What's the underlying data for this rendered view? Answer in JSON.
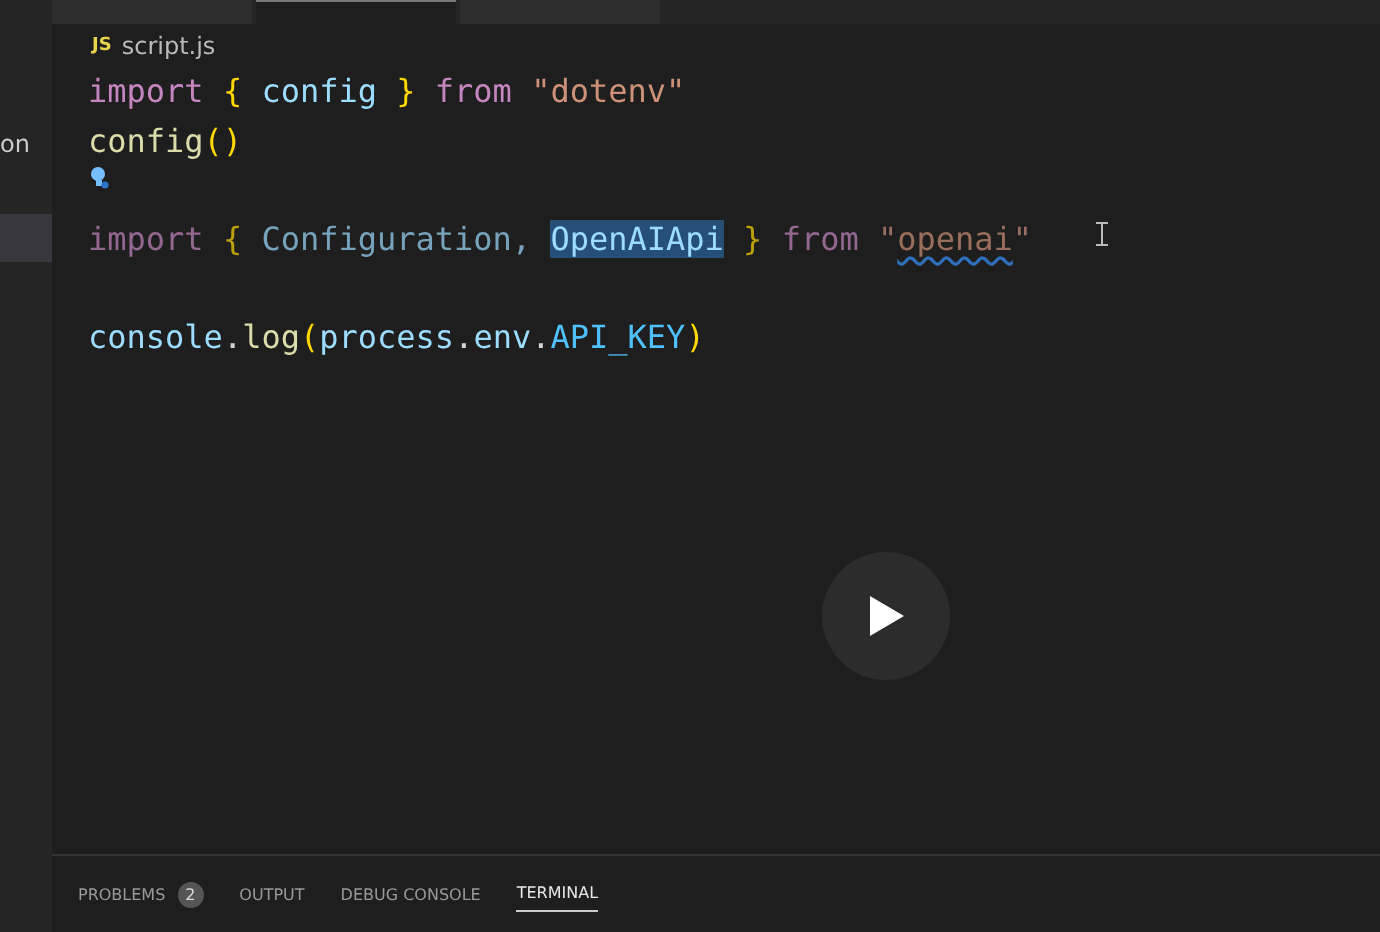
{
  "sidebar": {
    "items": [
      {
        "label": "on",
        "selected": false
      },
      {
        "selected": true
      }
    ]
  },
  "editor_tabs": [
    {
      "selected": false
    },
    {
      "selected": true
    },
    {
      "selected": false
    }
  ],
  "breadcrumb": {
    "file_icon": "JS",
    "file": "script.js"
  },
  "editor": {
    "lines": [
      {
        "faded": false,
        "tokens": [
          {
            "text": "import ",
            "kind": "keyword"
          },
          {
            "text": "{ ",
            "kind": "brace"
          },
          {
            "text": "config ",
            "kind": "variable"
          },
          {
            "text": "} ",
            "kind": "brace"
          },
          {
            "text": "from ",
            "kind": "keyword"
          },
          {
            "text": "\"dotenv\"",
            "kind": "string"
          }
        ]
      },
      {
        "faded": false,
        "tokens": [
          {
            "text": "config",
            "kind": "function"
          },
          {
            "text": "()",
            "kind": "brace"
          }
        ]
      },
      {
        "lightbulb": true
      },
      {
        "faded": true,
        "tokens": [
          {
            "text": "import ",
            "kind": "keyword"
          },
          {
            "text": "{ ",
            "kind": "brace"
          },
          {
            "text": "Configuration, ",
            "kind": "variable"
          },
          {
            "text": "OpenAIApi",
            "kind": "variable",
            "selected": true
          },
          {
            "text": " } ",
            "kind": "brace"
          },
          {
            "text": "from ",
            "kind": "keyword"
          },
          {
            "text": "\"",
            "kind": "string"
          },
          {
            "text": "openai",
            "kind": "string",
            "squiggle": true
          },
          {
            "text": "\"",
            "kind": "string"
          }
        ]
      },
      {
        "lightbulb": false
      },
      {
        "faded": false,
        "tokens": [
          {
            "text": "console",
            "kind": "variable"
          },
          {
            "text": ".",
            "kind": "plain"
          },
          {
            "text": "log",
            "kind": "function"
          },
          {
            "text": "(",
            "kind": "brace"
          },
          {
            "text": "process",
            "kind": "variable"
          },
          {
            "text": ".",
            "kind": "plain"
          },
          {
            "text": "env",
            "kind": "variable"
          },
          {
            "text": ".",
            "kind": "plain"
          },
          {
            "text": "API_KEY",
            "kind": "constant"
          },
          {
            "text": ")",
            "kind": "brace"
          }
        ]
      }
    ]
  },
  "panel": {
    "tabs": [
      {
        "label": "PROBLEMS",
        "badge": "2",
        "selected": false
      },
      {
        "label": "OUTPUT",
        "selected": false
      },
      {
        "label": "DEBUG CONSOLE",
        "selected": false
      },
      {
        "label": "TERMINAL",
        "selected": true
      }
    ]
  }
}
